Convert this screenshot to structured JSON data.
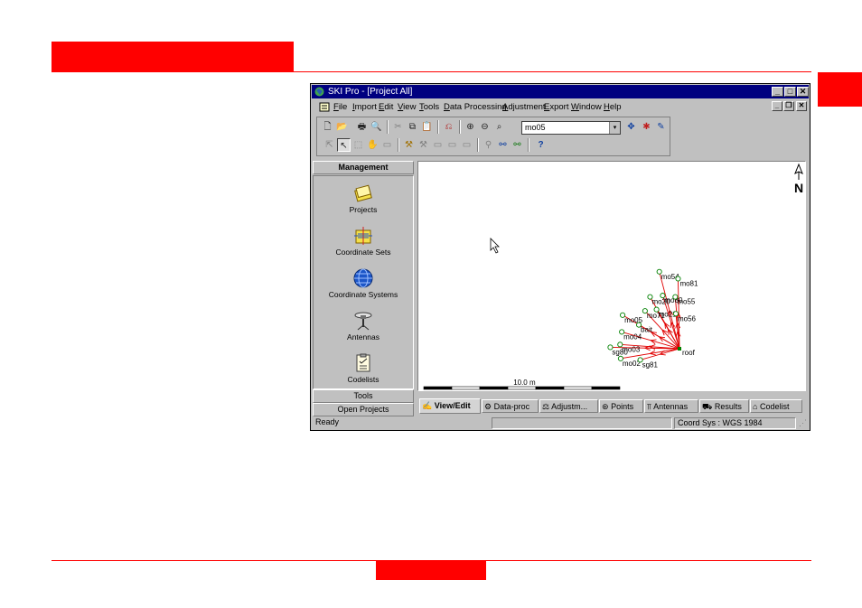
{
  "window": {
    "title": "SKI Pro - [Project All]",
    "caption_buttons": [
      "_",
      "□",
      "✕"
    ],
    "mdi_buttons": [
      "_",
      "❐",
      "✕"
    ]
  },
  "menu": [
    "File",
    "Import",
    "Edit",
    "View",
    "Tools",
    "Data Processing",
    "Adjustment",
    "Export",
    "Window",
    "Help"
  ],
  "toolbar": {
    "combo_value": "mo05",
    "combo_arrow": "▾"
  },
  "management": {
    "header": "Management",
    "items": [
      {
        "label": "Projects",
        "icon": "projects-icon"
      },
      {
        "label": "Coordinate Sets",
        "icon": "coordinate-sets-icon"
      },
      {
        "label": "Coordinate Systems",
        "icon": "globe-icon"
      },
      {
        "label": "Antennas",
        "icon": "antenna-icon"
      },
      {
        "label": "Codelists",
        "icon": "codelist-icon"
      }
    ],
    "footer_tools": "Tools",
    "footer_open": "Open Projects"
  },
  "view": {
    "north_label": "N",
    "scale_label": "10.0 m",
    "line_color": "#e00000",
    "point_color": "#008000",
    "reference_point": {
      "name": "roof",
      "x": 0,
      "y": 0
    },
    "points": [
      {
        "name": "mo54",
        "x": -7.2,
        "y": 27.5
      },
      {
        "name": "mo81",
        "x": -0.5,
        "y": 25.0
      },
      {
        "name": "mo20",
        "x": -10.5,
        "y": 18.5
      },
      {
        "name": "mo80",
        "x": -6.0,
        "y": 19.0
      },
      {
        "name": "mo55",
        "x": -1.5,
        "y": 18.5
      },
      {
        "name": "mo71",
        "x": -12.3,
        "y": 13.5
      },
      {
        "name": "mo21",
        "x": -8.2,
        "y": 14.0
      },
      {
        "name": "mo56",
        "x": -1.3,
        "y": 12.5
      },
      {
        "name": "mo05",
        "x": -20.3,
        "y": 12.0
      },
      {
        "name": "bait",
        "x": -14.5,
        "y": 8.5
      },
      {
        "name": "mo04",
        "x": -20.6,
        "y": 6.0
      },
      {
        "name": "mo03",
        "x": -21.2,
        "y": 1.5
      },
      {
        "name": "sg80",
        "x": -24.7,
        "y": 0.5
      },
      {
        "name": "mo02",
        "x": -21.0,
        "y": -3.5
      },
      {
        "name": "sg81",
        "x": -14.0,
        "y": -4.0
      }
    ]
  },
  "tabs": [
    {
      "label": "View/Edit",
      "icon": "view-edit-icon",
      "active": true
    },
    {
      "label": "Data-proc",
      "icon": "data-proc-icon",
      "active": false
    },
    {
      "label": "Adjustm...",
      "icon": "adjustment-icon",
      "active": false
    },
    {
      "label": "Points",
      "icon": "points-icon",
      "active": false
    },
    {
      "label": "Antennas",
      "icon": "antenna-icon",
      "active": false
    },
    {
      "label": "Results",
      "icon": "results-icon",
      "active": false
    },
    {
      "label": "Codelist",
      "icon": "codelist-icon",
      "active": false
    }
  ],
  "status": {
    "left": "Ready",
    "right": "Coord Sys : WGS 1984"
  }
}
